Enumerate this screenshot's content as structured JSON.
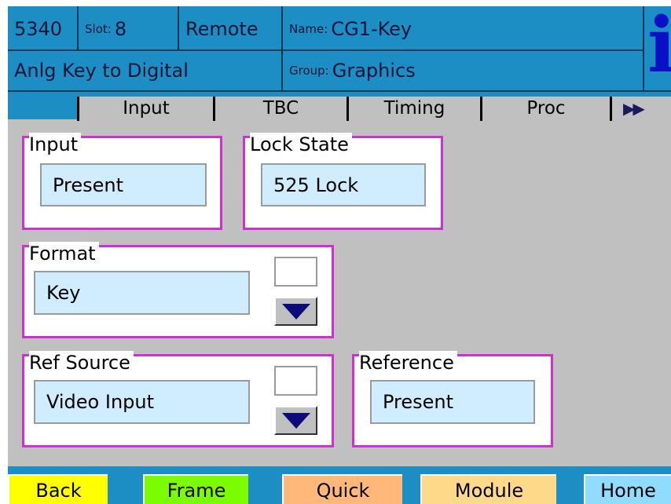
{
  "header": {
    "model": "5340",
    "slot_label": "Slot:",
    "slot_value": "8",
    "mode": "Remote",
    "name_label": "Name:",
    "name_value": "CG1-Key",
    "description": "Anlg Key to Digital",
    "group_label": "Group:",
    "group_value": "Graphics",
    "info_icon": "i"
  },
  "tabs": [
    "Input",
    "TBC",
    "Timing",
    "Proc"
  ],
  "tabs_more_icon": "▶▶",
  "panels": {
    "input": {
      "title": "Input",
      "value": "Present"
    },
    "lock_state": {
      "title": "Lock State",
      "value": "525 Lock"
    },
    "format": {
      "title": "Format",
      "value": "Key"
    },
    "ref_source": {
      "title": "Ref Source",
      "value": "Video Input"
    },
    "reference": {
      "title": "Reference",
      "value": "Present"
    }
  },
  "footer": {
    "buttons": [
      {
        "label": "Back",
        "color": "#ffff00"
      },
      {
        "label": "Frame",
        "color": "#7cfc00"
      },
      {
        "label": "Quick",
        "color": "#ffb77a"
      },
      {
        "label": "Module",
        "color": "#ffd98a"
      },
      {
        "label": "Home",
        "color": "#8fdcff"
      }
    ]
  },
  "colors": {
    "header_blue": "#1c8ec4",
    "panel_border": "#d030d0",
    "value_fill": "#d0ecff",
    "background": "#c0c0c0"
  }
}
